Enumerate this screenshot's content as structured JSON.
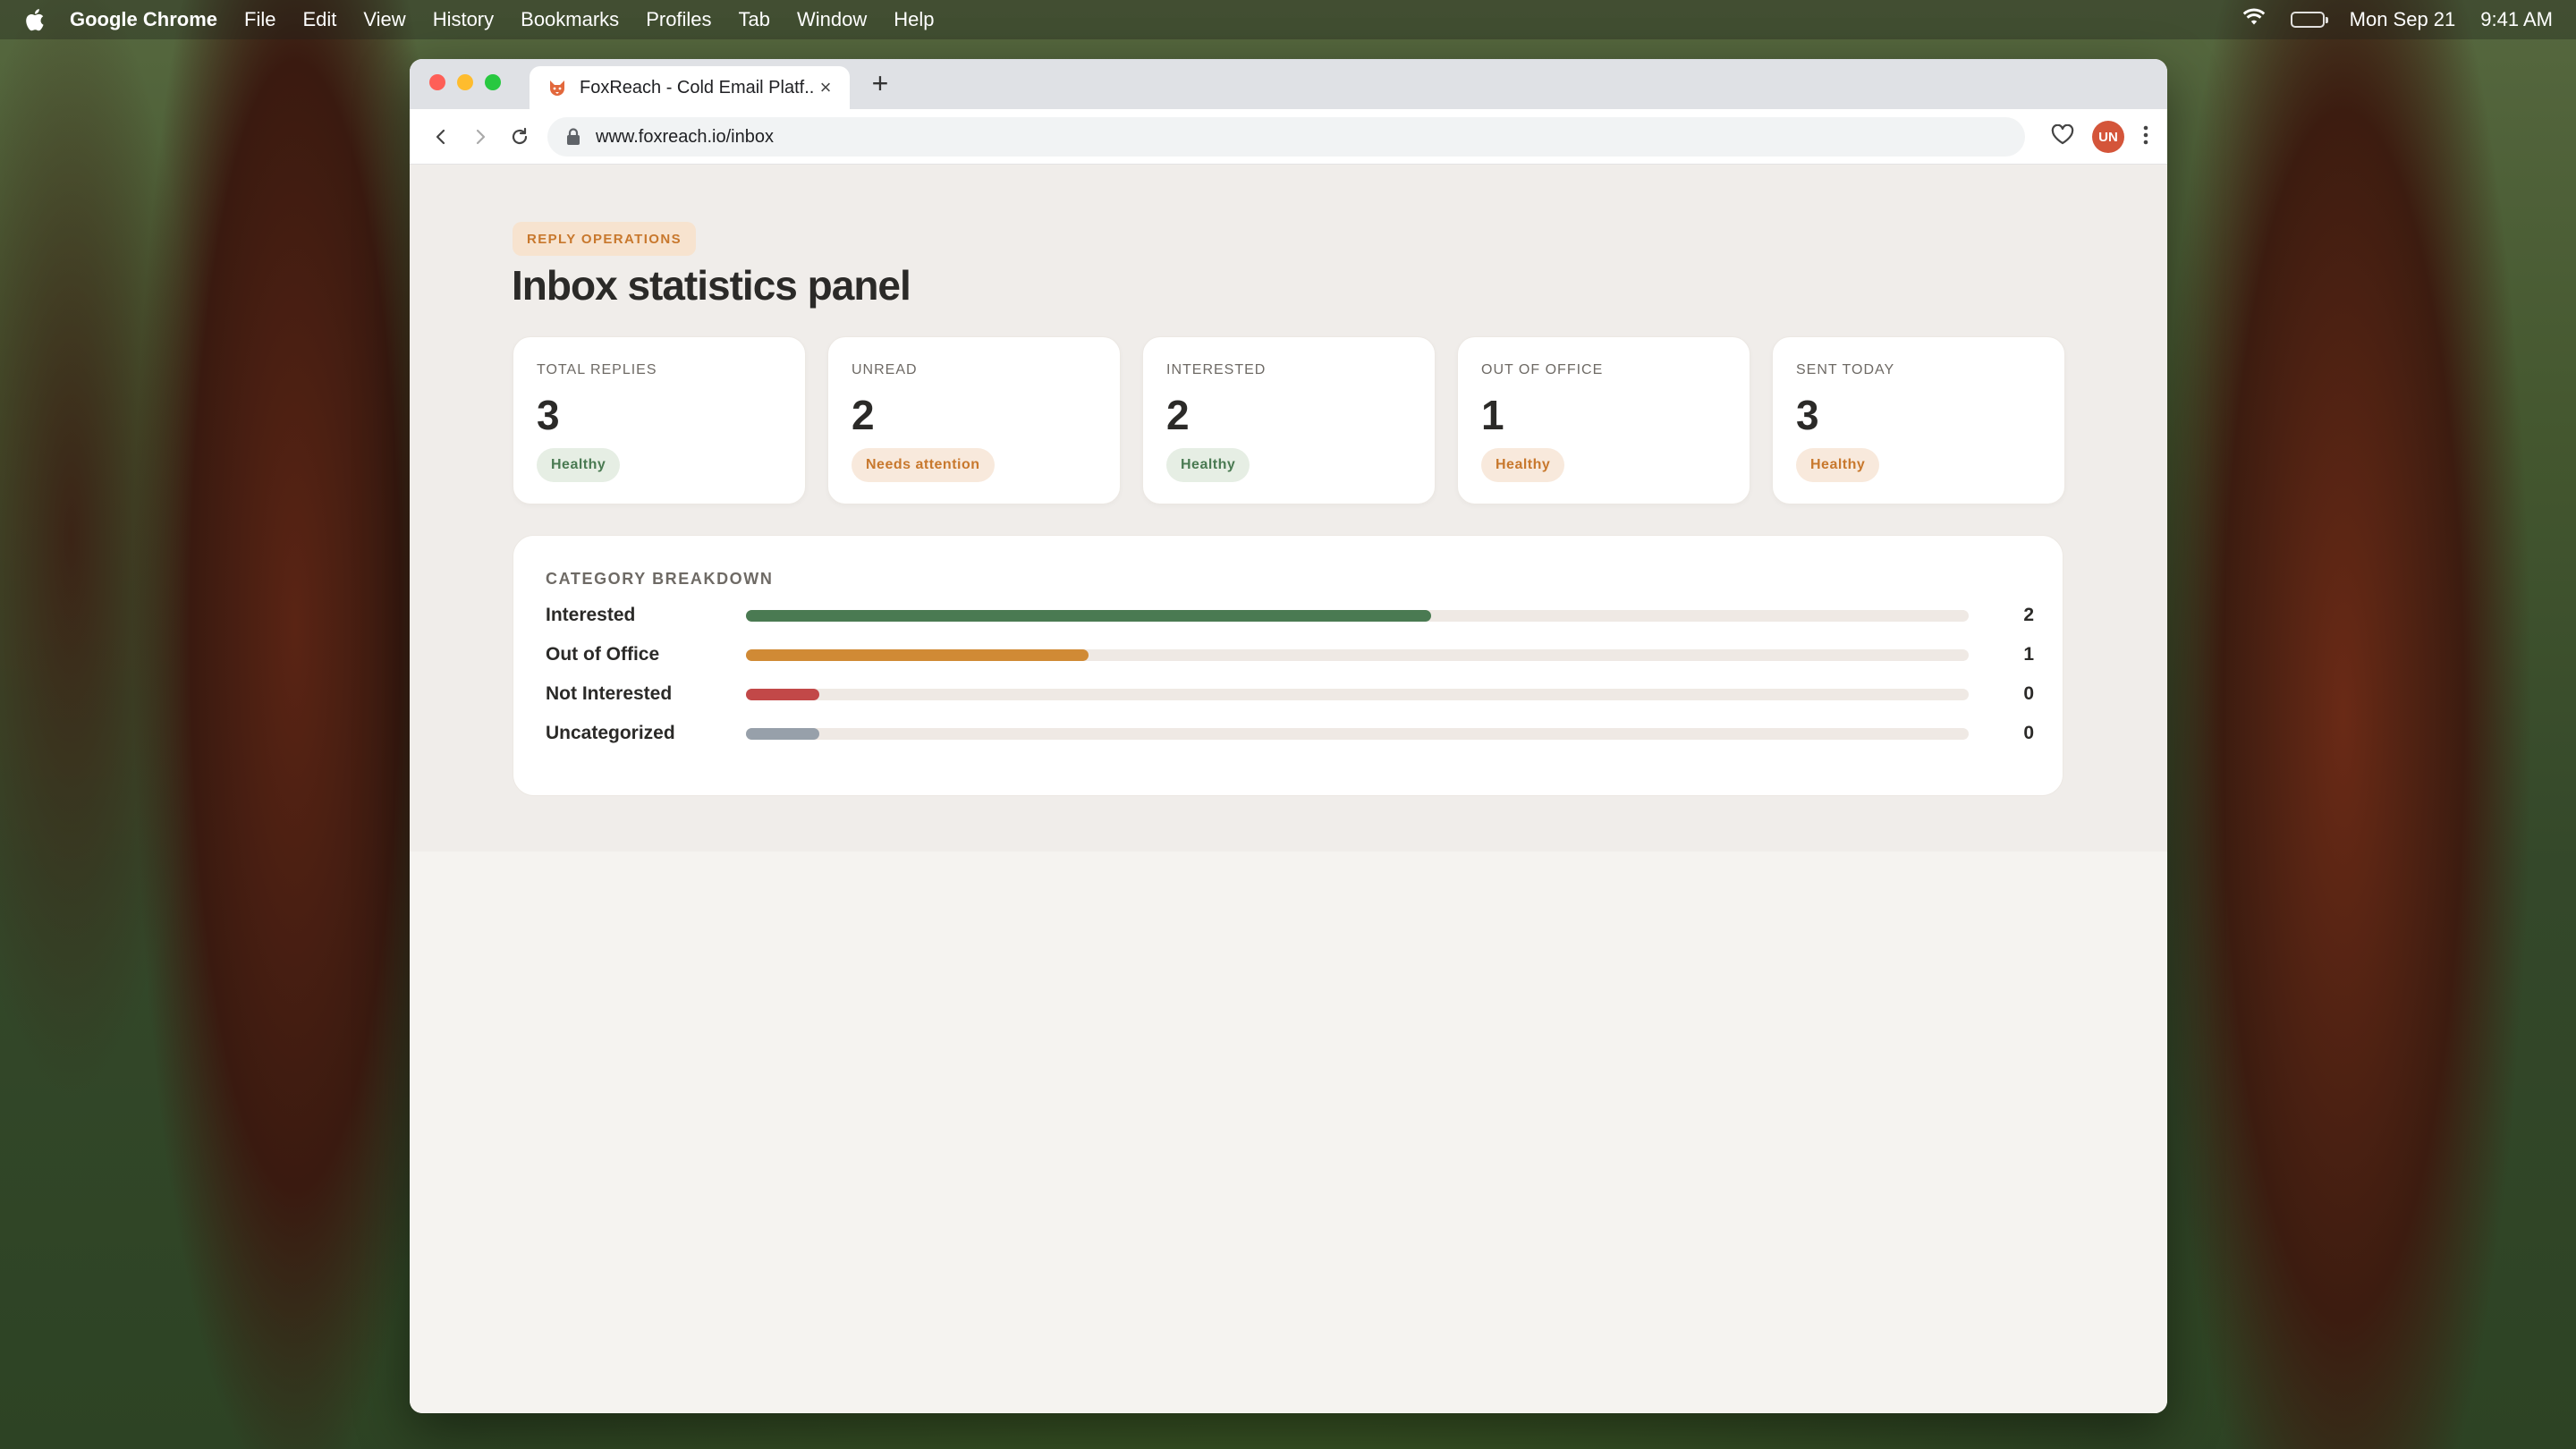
{
  "menubar": {
    "app_name": "Google Chrome",
    "items": [
      "File",
      "Edit",
      "View",
      "History",
      "Bookmarks",
      "Profiles",
      "Tab",
      "Window",
      "Help"
    ],
    "date": "Mon Sep 21",
    "time": "9:41 AM"
  },
  "browser": {
    "tab_title": "FoxReach - Cold Email Platf...",
    "url": "www.foxreach.io/inbox",
    "avatar_initials": "UN",
    "avatar_color": "#d4553a"
  },
  "page": {
    "eyebrow": "REPLY OPERATIONS",
    "title": "Inbox statistics panel"
  },
  "stats": [
    {
      "label": "TOTAL REPLIES",
      "value": "3",
      "badge": "Healthy",
      "badge_tone": "green"
    },
    {
      "label": "UNREAD",
      "value": "2",
      "badge": "Needs attention",
      "badge_tone": "orange"
    },
    {
      "label": "INTERESTED",
      "value": "2",
      "badge": "Healthy",
      "badge_tone": "green"
    },
    {
      "label": "OUT OF OFFICE",
      "value": "1",
      "badge": "Healthy",
      "badge_tone": "orange"
    },
    {
      "label": "SENT TODAY",
      "value": "3",
      "badge": "Healthy",
      "badge_tone": "orange"
    }
  ],
  "breakdown": {
    "title": "CATEGORY BREAKDOWN",
    "rows": [
      {
        "label": "Interested",
        "count": "2",
        "fill": 0.56,
        "color": "#4a7a52"
      },
      {
        "label": "Out of Office",
        "count": "1",
        "fill": 0.28,
        "color": "#d08a35"
      },
      {
        "label": "Not Interested",
        "count": "0",
        "fill": 0.06,
        "color": "#c24848"
      },
      {
        "label": "Uncategorized",
        "count": "0",
        "fill": 0.06,
        "color": "#97a0aa"
      }
    ]
  }
}
